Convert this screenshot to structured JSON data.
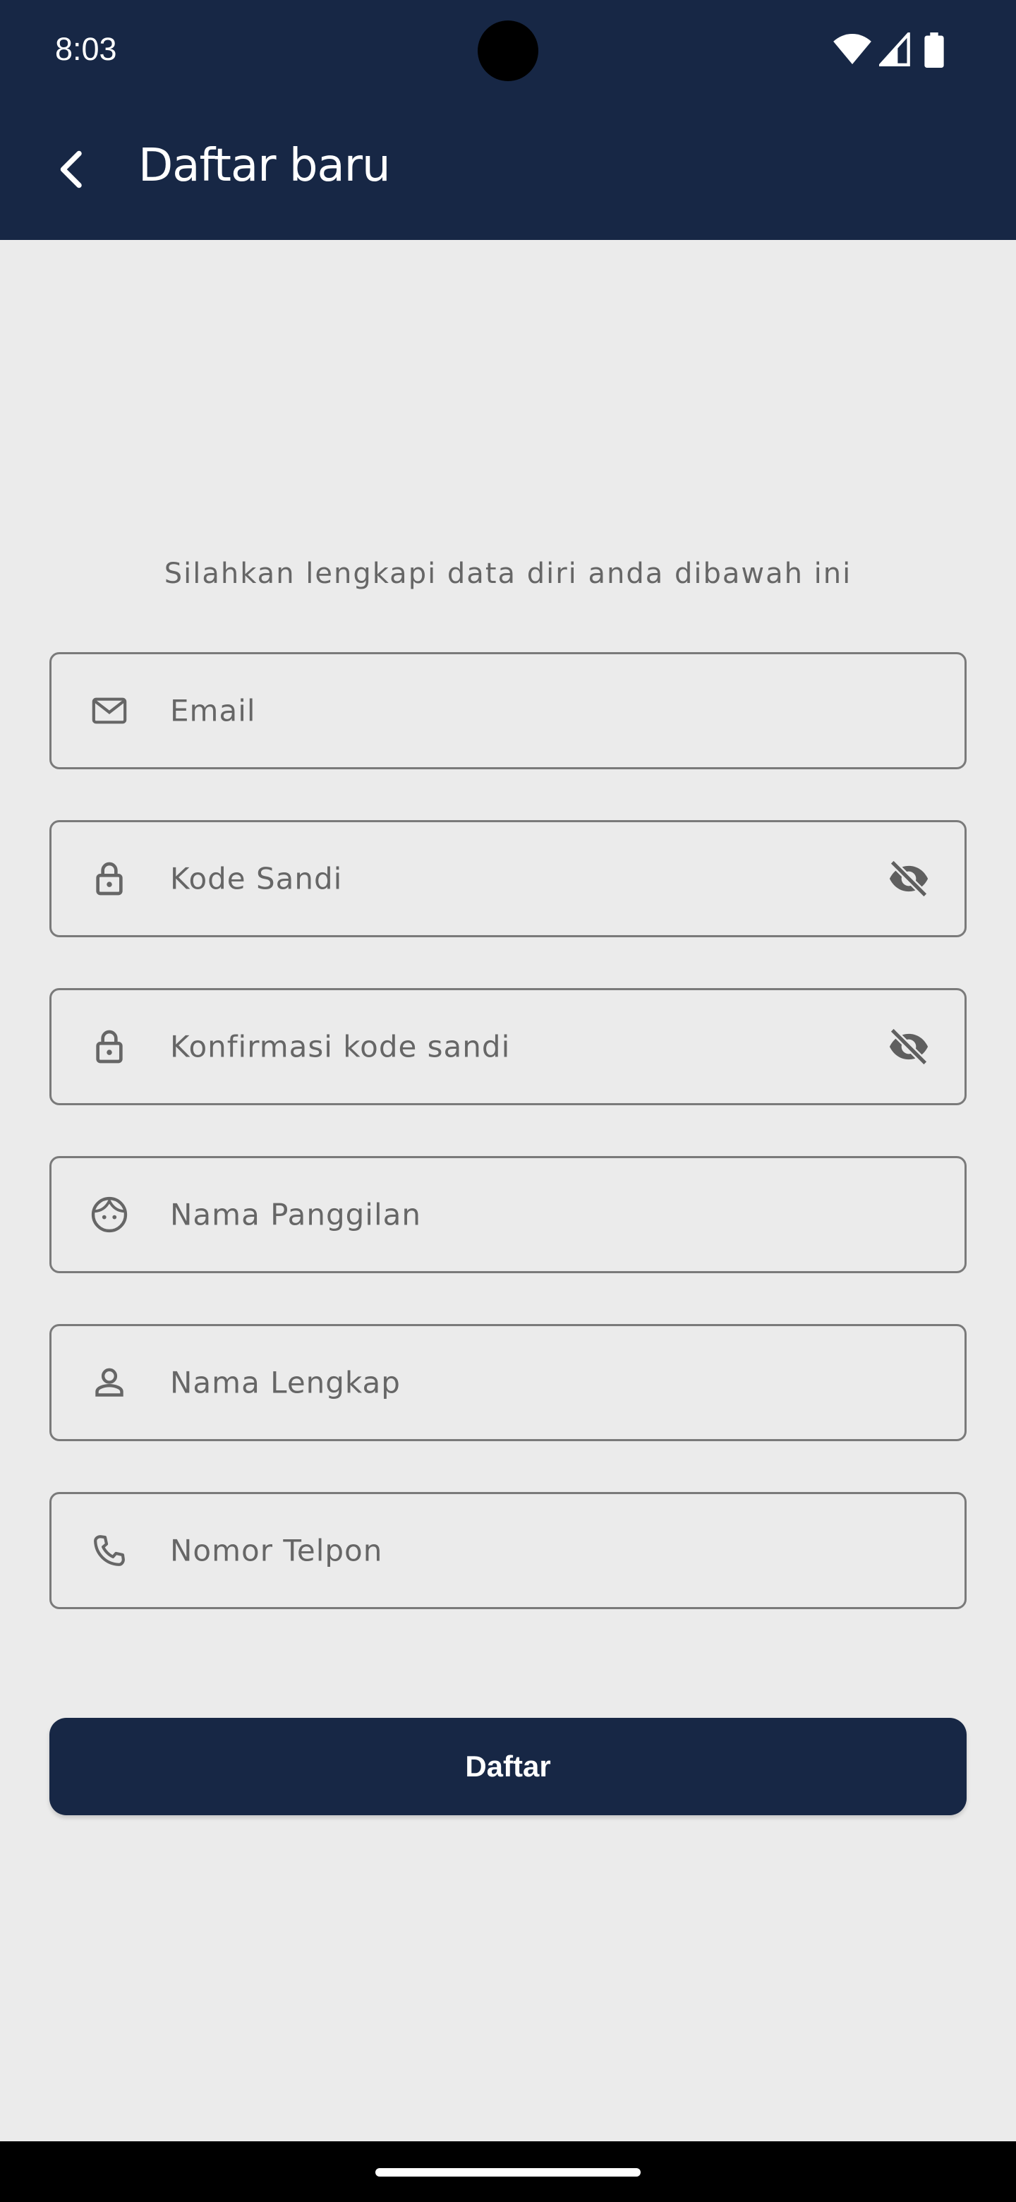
{
  "status_bar": {
    "time": "8:03"
  },
  "app_bar": {
    "title": "Daftar baru",
    "back_icon": "arrow-back-icon"
  },
  "form": {
    "instruction": "Silahkan lengkapi data diri anda dibawah ini",
    "fields": [
      {
        "placeholder": "Email",
        "icon": "mail-icon"
      },
      {
        "placeholder": "Kode Sandi",
        "icon": "lock-icon",
        "trailing_icon": "visibility-off-icon"
      },
      {
        "placeholder": "Konfirmasi kode sandi",
        "icon": "lock-icon",
        "trailing_icon": "visibility-off-icon"
      },
      {
        "placeholder": "Nama Panggilan",
        "icon": "face-icon"
      },
      {
        "placeholder": "Nama Lengkap",
        "icon": "person-icon"
      },
      {
        "placeholder": "Nomor Telpon",
        "icon": "phone-icon"
      }
    ],
    "submit_label": "Daftar"
  },
  "colors": {
    "primary": "#172745",
    "background": "#ebebeb",
    "field_border": "#7a7a7a",
    "placeholder_text": "#666666"
  }
}
